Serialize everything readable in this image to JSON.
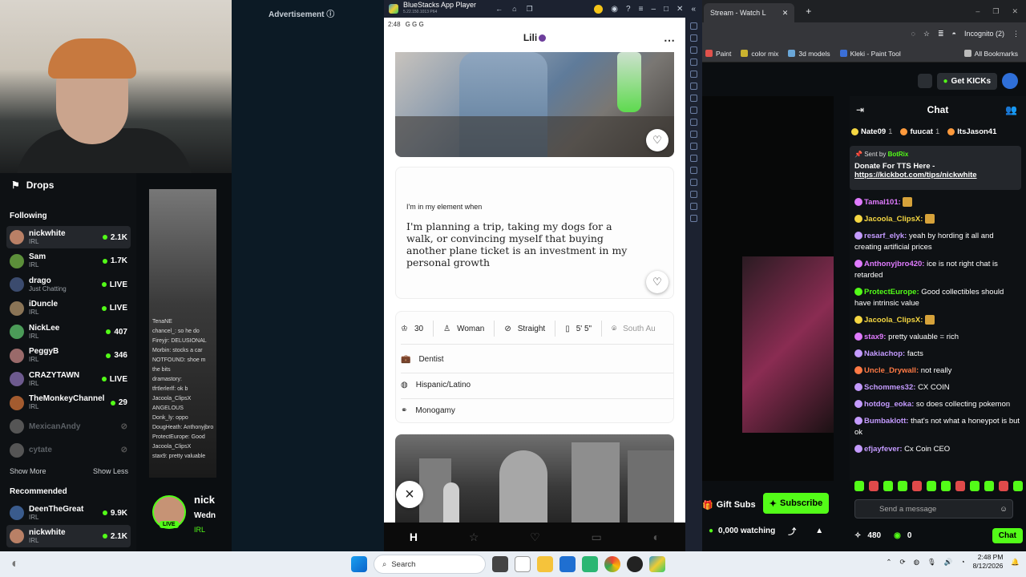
{
  "left_panel": {
    "drops_label": "Drops",
    "following_title": "Following",
    "following": [
      {
        "name": "nickwhite",
        "sub": "IRL",
        "value": "2.1K",
        "live": true,
        "active": true
      },
      {
        "name": "Sam",
        "sub": "IRL",
        "value": "1.7K",
        "live": true
      },
      {
        "name": "drago",
        "sub": "Just Chatting",
        "value": "LIVE",
        "live": true
      },
      {
        "name": "iDuncle",
        "sub": "IRL",
        "value": "LIVE",
        "live": true
      },
      {
        "name": "NickLee",
        "sub": "IRL",
        "value": "407",
        "live": true
      },
      {
        "name": "PeggyB",
        "sub": "IRL",
        "value": "346",
        "live": true
      },
      {
        "name": "CRAZYTAWN",
        "sub": "IRL",
        "value": "LIVE",
        "live": true
      },
      {
        "name": "TheMonkeyChannel",
        "sub": "IRL",
        "value": "29",
        "live": true
      },
      {
        "name": "MexicanAndy",
        "sub": "",
        "value": "",
        "live": false
      },
      {
        "name": "cytate",
        "sub": "",
        "value": "",
        "live": false
      }
    ],
    "show_more": "Show More",
    "show_less": "Show Less",
    "recommended_title": "Recommended",
    "recommended": [
      {
        "name": "DeenTheGreat",
        "sub": "IRL",
        "value": "9.9K"
      },
      {
        "name": "nickwhite",
        "sub": "IRL",
        "value": "2.1K"
      }
    ]
  },
  "stream_chat_overlay": [
    "TenaNE",
    "chancel_: so he do",
    "Fireyjr: DELUSIONAL",
    "Morbin: stocks a car",
    "NOTFOUND: shoe m",
    "the bits",
    "dramastory:",
    "tfrtlerlerlf: ok b",
    "Jacoola_ClipsX",
    "ANGELOUS",
    "Donk_ly: oppo",
    "DougHeath: Anthonyjbro",
    "ProtectEurope: Good",
    "Jacoola_ClipsX",
    "stax9: pretty valuable"
  ],
  "streamer_card": {
    "name": "nick",
    "day": "Wedn",
    "category": "IRL",
    "live_badge": "LIVE"
  },
  "ad": {
    "label": "Advertisement ⓘ"
  },
  "bluestacks": {
    "title": "BlueStacks App Player",
    "version": "5.22.150.1013 P64",
    "status_time": "2:48",
    "status_icons": "G G G"
  },
  "hinge": {
    "profile_name": "Lili",
    "prompt_question": "I'm in my element when",
    "prompt_answer": "I'm planning a trip, taking my dogs for a walk, or convincing myself that buying another plane ticket is an investment in my personal growth",
    "vitals": {
      "age": "30",
      "gender": "Woman",
      "orientation": "Straight",
      "height": "5' 5\"",
      "location": "South Au"
    },
    "details": {
      "job": "Dentist",
      "ethnicity": "Hispanic/Latino",
      "relationship": "Monogamy"
    },
    "close_icon": "×"
  },
  "browser": {
    "tab_title": "Stream - Watch L",
    "incognito": "Incognito (2)",
    "bookmarks": [
      "Paint",
      "color mix",
      "3d models",
      "Kleki - Paint Tool"
    ],
    "all_bookmarks": "All Bookmarks"
  },
  "kick": {
    "get_kicks": "Get KICKs",
    "chat_title": "Chat",
    "gifters": [
      {
        "name": "Nate09",
        "count": "1"
      },
      {
        "name": "fuucat",
        "count": "1"
      },
      {
        "name": "ItsJason41",
        "count": ""
      }
    ],
    "pinned": {
      "sent_by": "Sent by",
      "bot": "BotRix",
      "message": "Donate For TTS Here -",
      "link": "https://kickbot.com/tips/nickwhite"
    },
    "messages": [
      {
        "user": "Tamal101:",
        "text": "",
        "color": "#e07bff"
      },
      {
        "user": "Jacoola_ClipsX:",
        "text": "",
        "color": "#f5d742"
      },
      {
        "user": "resarf_elyk:",
        "text": "yeah by hording it all and creating artificial prices",
        "color": "#c49bff"
      },
      {
        "user": "Anthonyjbro420:",
        "text": "ice is not right chat is retarded",
        "color": "#e07bff"
      },
      {
        "user": "ProtectEurope:",
        "text": "Good collectibles should have intrinsic value",
        "color": "#53fc18"
      },
      {
        "user": "Jacoola_ClipsX:",
        "text": "",
        "color": "#f5d742"
      },
      {
        "user": "stax9:",
        "text": "pretty valuable = rich",
        "color": "#e07bff"
      },
      {
        "user": "Nakiachop:",
        "text": "facts",
        "color": "#c49bff"
      },
      {
        "user": "Uncle_Drywall:",
        "text": "not really",
        "color": "#ff7a45"
      },
      {
        "user": "Schommes32:",
        "text": "CX COIN",
        "color": "#c49bff"
      },
      {
        "user": "hotdog_eoka:",
        "text": "so does collecting pokemon",
        "color": "#c49bff"
      },
      {
        "user": "Bumbaklott:",
        "text": "that's not what a honeypot is but ok",
        "color": "#c49bff"
      },
      {
        "user": "efjayfever:",
        "text": "Cx Coin CEO",
        "color": "#c49bff"
      }
    ],
    "send_placeholder": "Send a message",
    "points": "480",
    "kicks": "0",
    "chat_button": "Chat",
    "gift_subs": "Gift Subs",
    "subscribe": "Subscribe",
    "watching": "0,000 watching"
  },
  "taskbar": {
    "search": "Search",
    "time": "2:48 PM",
    "date": "8/12/2026"
  }
}
